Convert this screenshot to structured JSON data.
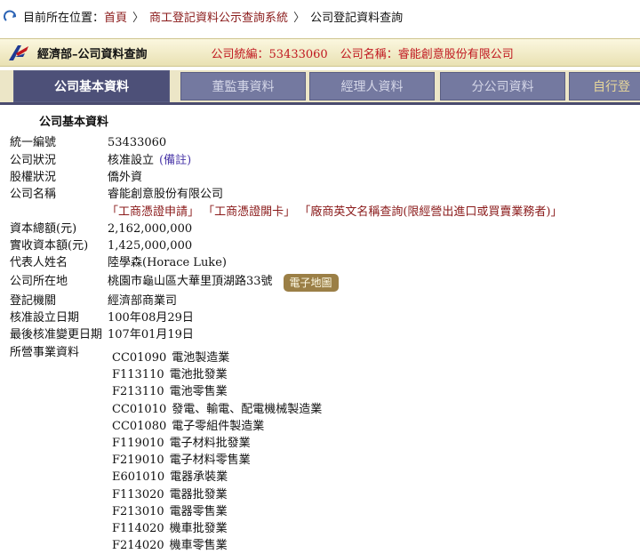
{
  "breadcrumb": {
    "prefix": "目前所在位置：",
    "items": [
      "首頁",
      "商工登記資料公示查詢系統",
      "公司登記資料查詢"
    ],
    "separator": "〉"
  },
  "banner": {
    "title": "經濟部–公司資料查詢",
    "id_label": "公司統編：53433060",
    "name_label": "公司名稱：睿能創意股份有限公司"
  },
  "tabs": [
    "公司基本資料",
    "董監事資料",
    "經理人資料",
    "分公司資料",
    "自行登"
  ],
  "section_title": "公司基本資料",
  "fields": {
    "tax_id": {
      "label": "統一編號",
      "value": "53433060"
    },
    "status": {
      "label": "公司狀況",
      "value": "核准設立",
      "note": "(備註)"
    },
    "equity": {
      "label": "股權狀況",
      "value": "僑外資"
    },
    "name": {
      "label": "公司名稱",
      "value": "睿能創意股份有限公司"
    },
    "capital_total": {
      "label": "資本總額(元)",
      "value": "2,162,000,000"
    },
    "capital_paid": {
      "label": "實收資本額(元)",
      "value": "1,425,000,000"
    },
    "representative": {
      "label": "代表人姓名",
      "value": "陸學森(Horace Luke)"
    },
    "address": {
      "label": "公司所在地",
      "value": "桃園市龜山區大華里頂湖路33號"
    },
    "authority": {
      "label": "登記機關",
      "value": "經濟部商業司"
    },
    "approval_date": {
      "label": "核准設立日期",
      "value": "100年08月29日"
    },
    "last_change_date": {
      "label": "最後核准變更日期",
      "value": "107年01月19日"
    },
    "business": {
      "label": "所營事業資料"
    }
  },
  "name_links": {
    "link1": "「工商憑證申請」",
    "link2": "「工商憑證開卡」",
    "link3": "「廠商英文名稱查詢(限經營出進口或買賣業務者)」"
  },
  "map_button": "電子地圖",
  "business_items": [
    {
      "code": "CC01090",
      "desc": "電池製造業"
    },
    {
      "code": "F113110",
      "desc": "電池批發業"
    },
    {
      "code": "F213110",
      "desc": "電池零售業"
    },
    {
      "code": "CC01010",
      "desc": "發電、輸電、配電機械製造業"
    },
    {
      "code": "CC01080",
      "desc": "電子零組件製造業"
    },
    {
      "code": "F119010",
      "desc": "電子材料批發業"
    },
    {
      "code": "F219010",
      "desc": "電子材料零售業"
    },
    {
      "code": "E601010",
      "desc": "電器承裝業"
    },
    {
      "code": "F113020",
      "desc": "電器批發業"
    },
    {
      "code": "F213010",
      "desc": "電器零售業"
    },
    {
      "code": "F114020",
      "desc": "機車批發業"
    },
    {
      "code": "F214020",
      "desc": "機車零售業"
    }
  ],
  "colors": {
    "accent_red": "#c0171f",
    "tab_active": "#4d5078",
    "tab": "#7479a0",
    "banner_bg": "#efe8c4"
  }
}
